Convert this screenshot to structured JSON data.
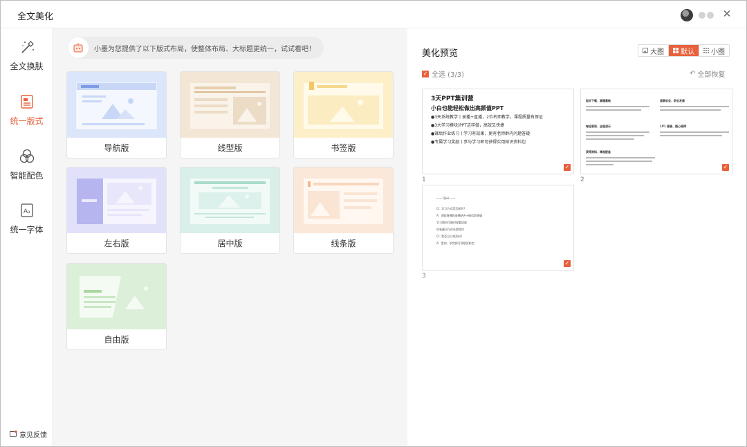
{
  "window": {
    "title": "全文美化"
  },
  "nav": {
    "items": [
      {
        "label": "全文换肤",
        "icon": "magic-wand-icon",
        "active": false
      },
      {
        "label": "统一版式",
        "icon": "layout-icon",
        "active": true
      },
      {
        "label": "智能配色",
        "icon": "color-circles-icon",
        "active": false
      },
      {
        "label": "统一字体",
        "icon": "font-icon",
        "active": false
      }
    ],
    "feedback_label": "意见反馈"
  },
  "middle": {
    "hint": "小墨为您提供了以下版式布局，使整体布局、大标题更统一，试试看吧！",
    "layouts": [
      {
        "label": "导航版",
        "color": "#dbe6fb"
      },
      {
        "label": "线型版",
        "color": "#f3e6d4"
      },
      {
        "label": "书签版",
        "color": "#fdf0c9"
      },
      {
        "label": "左右版",
        "color": "#e2e1fa"
      },
      {
        "label": "居中版",
        "color": "#d9efe9"
      },
      {
        "label": "线条版",
        "color": "#fbe8d9"
      },
      {
        "label": "自由版",
        "color": "#dcefd9"
      }
    ]
  },
  "preview": {
    "title": "美化预览",
    "view_modes": [
      {
        "label": "大图",
        "active": false
      },
      {
        "label": "默认",
        "active": true
      },
      {
        "label": "小图",
        "active": false
      }
    ],
    "select_all": "全选 (3/3)",
    "restore": "全部恢复",
    "slides": [
      {
        "num": "1",
        "title": "3天PPT集训营",
        "subtitle": "小白也能轻松做出高颜值PPT",
        "lines": [
          "●3天系统教学丨录播+直播，2位名师教学，课程质量有保证",
          "●3大学习模块|PPT这样做，高效又快捷",
          "●课后作业练习丨学习有效果，更有老师群内问题答疑",
          "●专属学习奖励丨参与学习即可获得实用知识资料包"
        ]
      },
      {
        "num": "2",
        "headings": [
          "起步下载、掌握基础",
          "場景机会、职业发展",
          "每组表现、全程演示",
          "1V1 答疑、随心规律",
          "获得资料、精准配备"
        ]
      },
      {
        "num": "3",
        "lines": [
          "—— Q&A ——",
          "Q：学习方式是怎样的?",
          "A：课程直播和录播结合+微信群答疑",
          "学习期间可随时观看回放",
          "如有疑问可在社群提问",
          "Q：是否可以领资料?",
          "A：是的，学完即可领取资料包"
        ]
      }
    ]
  },
  "colors": {
    "accent": "#e8613c",
    "panel_bg": "#f5f5f5"
  }
}
